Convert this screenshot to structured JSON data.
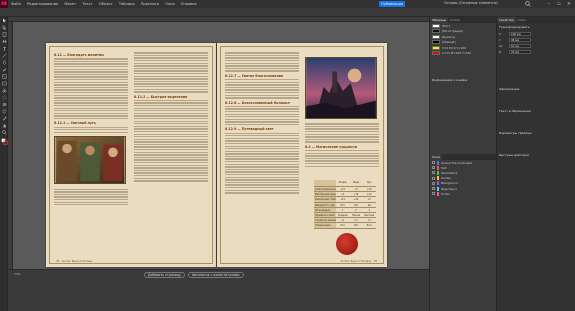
{
  "app": {
    "logo": "Id",
    "menu": [
      "Файл",
      "Редактирование",
      "Макет",
      "Текст",
      "Объект",
      "Таблица",
      "Просмотр",
      "Окно",
      "Справка"
    ],
    "share_label": "Публикация",
    "workspace_label": "Основы (Основные элементы)",
    "doc_title_left": "Проект Земли Ахнуов Не Свечей · 1 @ 26% [WA]",
    "doc_tab": "Проклятый Анимал Fire Controlled · 4 pattern.indd @ 73%"
  },
  "canvas": {
    "left_page": {
      "headings": [
        "8.12 — Благодать молитвы",
        "8.12.1 — Светлый путь",
        "8.12.2 — Быстрое исцеление"
      ],
      "footer": "34 · Anima: Beyond Fantasy"
    },
    "right_page": {
      "headings": [
        "8.12.7 — Святое благословение",
        "8.12.8 — Благословенный Колокол",
        "8.12.9 — Путеводный свет",
        "8.2 — Магические сущности"
      ],
      "footer": "Anima: Beyond Fantasy · 35",
      "table": {
        "columns": [
          "",
          "Эльфы",
          "Люди",
          "Дух"
        ],
        "rows": [
          [
            "Сопротивление магии",
            "+10",
            "+5",
            "+20"
          ],
          [
            "Ментальная защита",
            "+5",
            "+10",
            "+15"
          ],
          [
            "Физическая стойкость",
            "+15",
            "+10",
            "+5"
          ],
          [
            "Иммунитет к яду",
            "Нет",
            "Нет",
            "Да"
          ],
          [
            "Регенерация",
            "1",
            "2",
            "4"
          ],
          [
            "Привязка к мане",
            "Средняя",
            "Низкая",
            "Высокая"
          ],
          [
            "Стоимость заклинаний",
            "×1",
            "×2",
            "×1"
          ],
          [
            "Ограничения",
            "Нет",
            "Нет",
            "Есть"
          ]
        ]
      }
    }
  },
  "statusbar": {
    "add_page_label": "Добавить страницу",
    "flow_label": "Автопоток с колонтитулами",
    "zoom": "73%"
  },
  "panels_mid": {
    "tabs": [
      "Образцы",
      "Стили"
    ],
    "swatches": [
      {
        "name": "[Нет]",
        "color": "#ffffff"
      },
      {
        "name": "[Регистрация]",
        "color": "#111111"
      },
      {
        "name": "[Бумага]",
        "color": "#f5f5f5"
      },
      {
        "name": "[Чёрный]",
        "color": "#000000"
      },
      {
        "name": "C=0 M=0 Y=100",
        "color": "#ffea00"
      },
      {
        "name": "C=15 M=100 Y=100",
        "color": "#c8102e"
      }
    ],
    "section": "Информация о ячейке",
    "layers_title": "Слои",
    "layers": [
      {
        "name": "Arcana Fire Controlled",
        "color": "#4d7cff"
      },
      {
        "name": "Text",
        "color": "#ff4d4d"
      },
      {
        "name": "Illustrations",
        "color": "#2fcf4a"
      },
      {
        "name": "Guides",
        "color": "#ffb84d"
      },
      {
        "name": "Background",
        "color": "#b44dff"
      },
      {
        "name": "Page Decor",
        "color": "#4dd2ff"
      },
      {
        "name": "Footer",
        "color": "#ff4db8"
      }
    ]
  },
  "panels_right": {
    "tabs": [
      "Свойства",
      "Слои"
    ],
    "section_transform": "Трансформировать",
    "fields": [
      {
        "label": "X:",
        "value": "128 мм"
      },
      {
        "label": "Y:",
        "value": "48 мм"
      },
      {
        "label": "Ш:",
        "value": "62 мм"
      },
      {
        "label": "В:",
        "value": "22 мм"
      }
    ],
    "section_appearance": "Оформление",
    "section_text": "Текст в обрамлении",
    "section_table": "Параметры таблицы",
    "section_export": "Быстрые действия"
  }
}
